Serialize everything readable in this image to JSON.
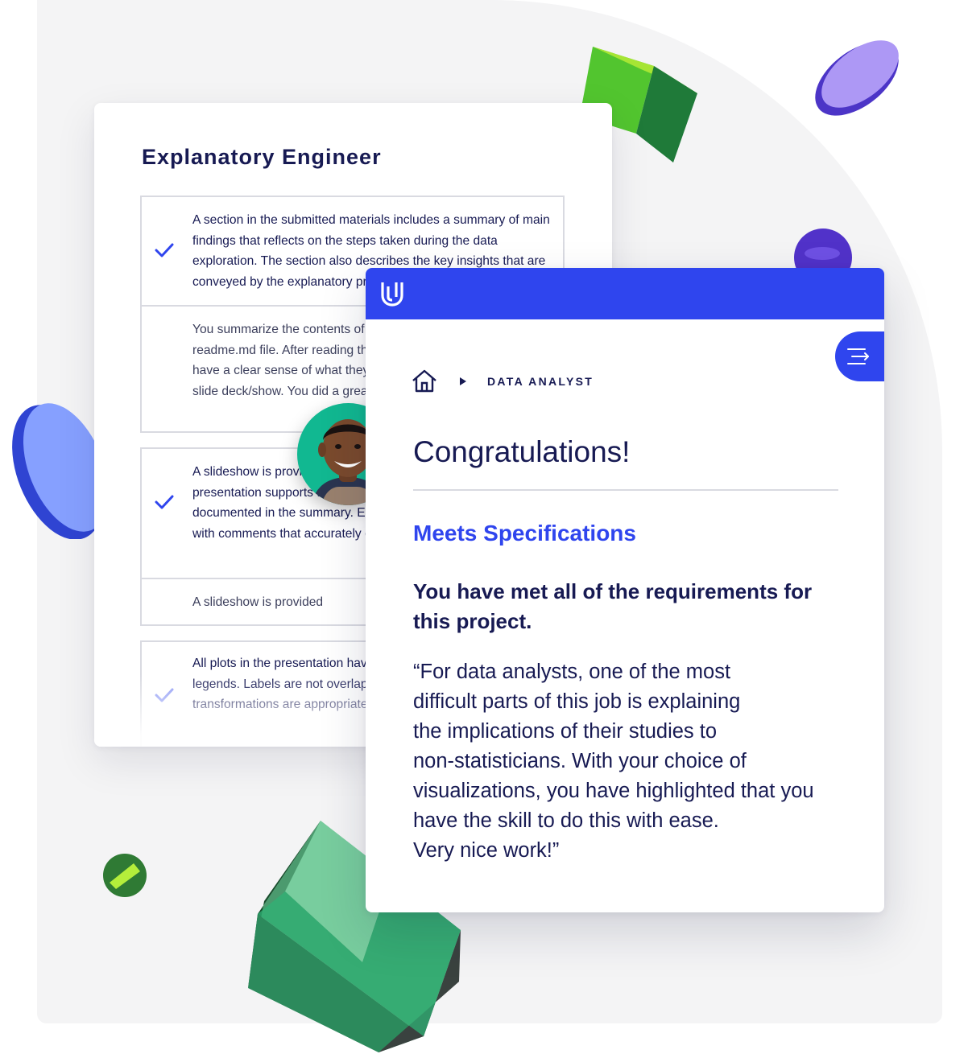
{
  "back_card": {
    "title": "Explanatory Engineer",
    "rubric_1": {
      "criteria": "A section in the submitted materials includes a summary of main findings that reflects on the steps taken during the data exploration. The section also describes the key insights that are conveyed by the explanatory presentation.",
      "review": "You summarize the contents of your exploration in your readme.md file. After reading the README, a reader should have a clear sense of what they will find in the exploration and slide deck/show. You did a great job in this regard. Very nice."
    },
    "rubric_2": {
      "criteria": "A slideshow is provided. Each visualization used in the presentation supports the insights. The insights match those documented in the summary. Each visualization is associated with comments that accurately depict their purpose.",
      "review": "A slideshow is provided"
    },
    "rubric_3": {
      "criteria": "All plots in the presentation have titles, labeled axes and legends. Labels are not overlapping. Plot type, encodings, and transformations are appropriate."
    }
  },
  "front_card": {
    "breadcrumb": {
      "label": "DATA ANALYST"
    },
    "heading": "Congratulations!",
    "status": "Meets Specifications",
    "summary": "You have met all of the requirements for this project.",
    "quote": "“For data analysts, one of the most\ndifficult parts of this job is explaining\nthe implications of their studies to\nnon-statisticians. With your choice of\nvisualizations, you have highlighted that you\nhave the skill to do this with ease.\nVery nice work!”"
  },
  "icons": {
    "logo": "udacity-logo-icon",
    "menu": "menu-collapse-icon",
    "home": "home-icon",
    "breadcrumb_separator": "caret-right-icon",
    "check": "check-icon"
  },
  "colors": {
    "brand_blue": "#2f45ee",
    "navy_text": "#171a53",
    "border_gray": "#d9dae1",
    "avatar_teal": "#11b891"
  }
}
